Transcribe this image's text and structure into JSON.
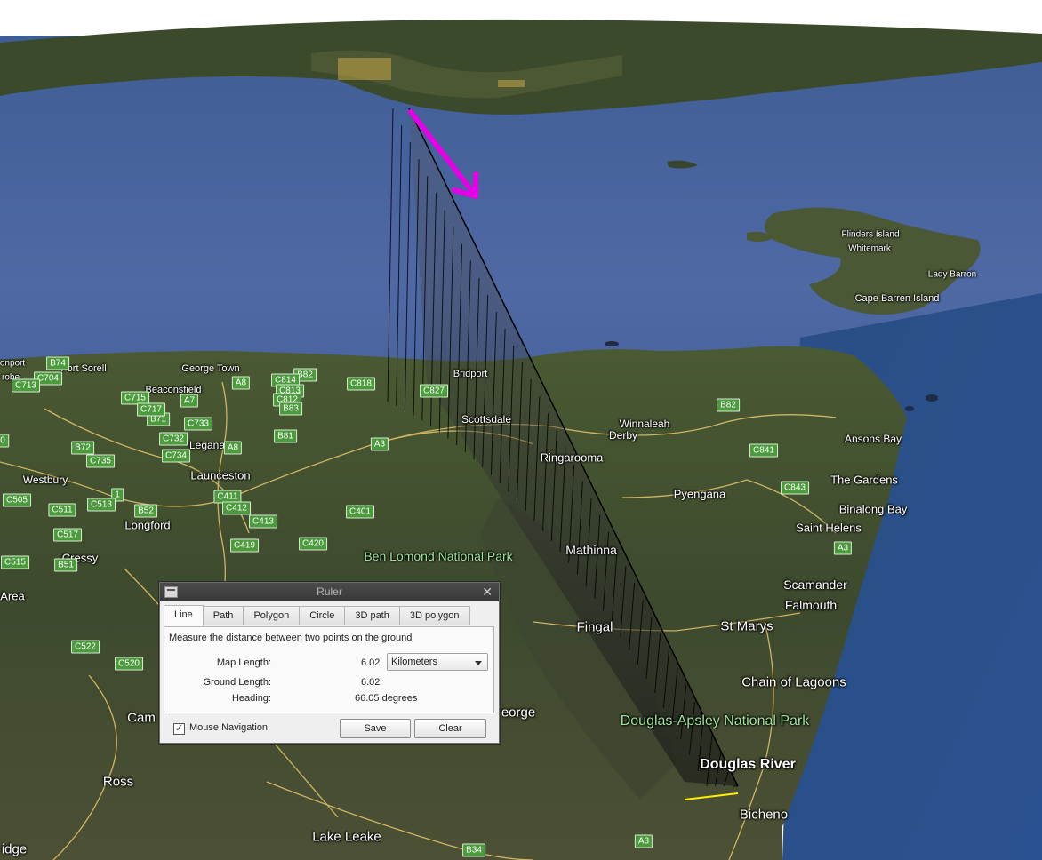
{
  "map": {
    "places": [
      {
        "id": "port-sorell",
        "name": "Port Sorell"
      },
      {
        "id": "george-town",
        "name": "George Town"
      },
      {
        "id": "beaconsfield",
        "name": "Beaconsfield"
      },
      {
        "id": "legana",
        "name": "Legana"
      },
      {
        "id": "launceston",
        "name": "Launceston"
      },
      {
        "id": "westbury",
        "name": "Westbury"
      },
      {
        "id": "longford",
        "name": "Longford"
      },
      {
        "id": "cressy",
        "name": "Cressy"
      },
      {
        "id": "bridport",
        "name": "Bridport"
      },
      {
        "id": "scottsdale",
        "name": "Scottsdale"
      },
      {
        "id": "winnaleah",
        "name": "Winnaleah"
      },
      {
        "id": "derby",
        "name": "Derby"
      },
      {
        "id": "ringarooma",
        "name": "Ringarooma"
      },
      {
        "id": "pyengana",
        "name": "Pyengana"
      },
      {
        "id": "mathinna",
        "name": "Mathinna"
      },
      {
        "id": "fingal",
        "name": "Fingal"
      },
      {
        "id": "st-marys",
        "name": "St Marys"
      },
      {
        "id": "ansons-bay",
        "name": "Ansons Bay"
      },
      {
        "id": "the-gardens",
        "name": "The Gardens"
      },
      {
        "id": "binalong-bay",
        "name": "Binalong Bay"
      },
      {
        "id": "saint-helens",
        "name": "Saint Helens"
      },
      {
        "id": "scamander",
        "name": "Scamander"
      },
      {
        "id": "falmouth",
        "name": "Falmouth"
      },
      {
        "id": "chain-of-lagoons",
        "name": "Chain of Lagoons"
      },
      {
        "id": "douglas-river",
        "name": "Douglas River"
      },
      {
        "id": "bicheno",
        "name": "Bicheno"
      },
      {
        "id": "lake-leake",
        "name": "Lake Leake"
      },
      {
        "id": "ross",
        "name": "Ross"
      },
      {
        "id": "flinders-island",
        "name": "Flinders Island"
      },
      {
        "id": "whitemark",
        "name": "Whitemark"
      },
      {
        "id": "lady-barron",
        "name": "Lady Barron"
      },
      {
        "id": "cape-barren-island",
        "name": "Cape Barren Island"
      },
      {
        "id": "devonport-fragment",
        "name": "onport"
      },
      {
        "id": "latrobe-fragment",
        "name": "robe"
      },
      {
        "id": "campbell-fragment",
        "name": "Cam"
      },
      {
        "id": "george-fragment",
        "name": "eorge"
      },
      {
        "id": "bridge-fragment",
        "name": "idge"
      },
      {
        "id": "area-fragment",
        "name": "Area"
      }
    ],
    "parks": [
      {
        "id": "ben-lomond",
        "name": "Ben Lomond National Park"
      },
      {
        "id": "douglas-apsley",
        "name": "Douglas-Apsley National Park"
      }
    ],
    "road_shields": [
      "B74",
      "C704",
      "C713",
      "A8",
      "B82",
      "C814",
      "C813",
      "C812",
      "B83",
      "C818",
      "C715",
      "A7",
      "B71",
      "C717",
      "C733",
      "B72",
      "C732",
      "A8",
      "B81",
      "C827",
      "A3",
      "B82",
      "C841",
      "C843",
      "A3",
      "C735",
      "C734",
      "C505",
      "C511",
      "1",
      "C513",
      "B52",
      "C411",
      "C412",
      "C413",
      "C401",
      "C517",
      "C419",
      "C420",
      "C515",
      "B51",
      "C522",
      "C520",
      "A3",
      "B34",
      "0"
    ],
    "arrow_color": "#e600e6",
    "measure_line_color": "#000000"
  },
  "ruler": {
    "title": "Ruler",
    "tabs": [
      "Line",
      "Path",
      "Polygon",
      "Circle",
      "3D path",
      "3D polygon"
    ],
    "active_tab": "Line",
    "description": "Measure the distance between two points on the ground",
    "map_length_label": "Map Length:",
    "map_length_value": "6.02",
    "unit": "Kilometers",
    "ground_length_label": "Ground Length:",
    "ground_length_value": "6.02",
    "heading_label": "Heading:",
    "heading_value": "66.05 degrees",
    "mouse_nav_label": "Mouse Navigation",
    "mouse_nav_checked": true,
    "save_label": "Save",
    "clear_label": "Clear"
  }
}
